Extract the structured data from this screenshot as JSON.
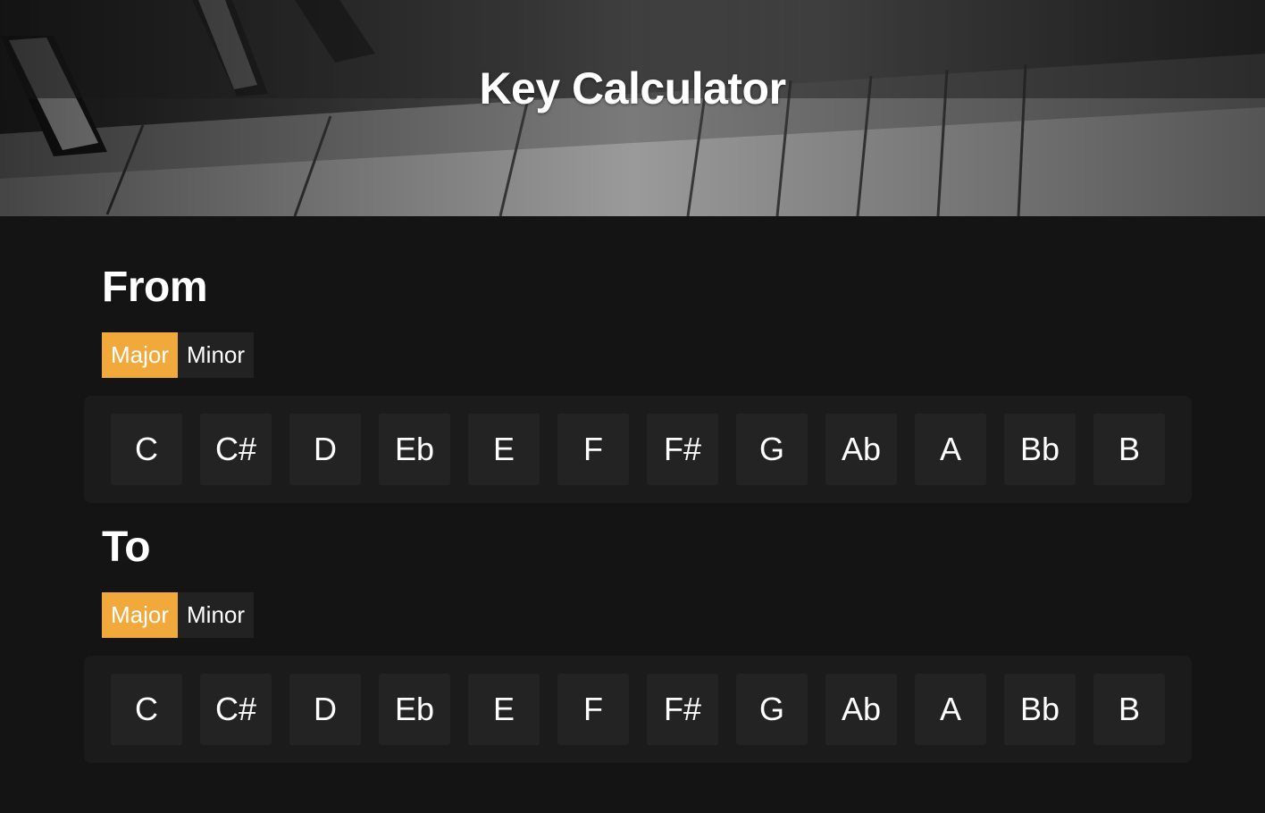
{
  "header": {
    "title": "Key Calculator"
  },
  "from": {
    "title": "From",
    "modes": [
      "Major",
      "Minor"
    ],
    "active_mode": "Major",
    "keys": [
      "C",
      "C#",
      "D",
      "Eb",
      "E",
      "F",
      "F#",
      "G",
      "Ab",
      "A",
      "Bb",
      "B"
    ]
  },
  "to": {
    "title": "To",
    "modes": [
      "Major",
      "Minor"
    ],
    "active_mode": "Major",
    "keys": [
      "C",
      "C#",
      "D",
      "Eb",
      "E",
      "F",
      "F#",
      "G",
      "Ab",
      "A",
      "Bb",
      "B"
    ]
  },
  "colors": {
    "accent": "#f2a93b",
    "background": "#141414",
    "key": "#232323"
  }
}
